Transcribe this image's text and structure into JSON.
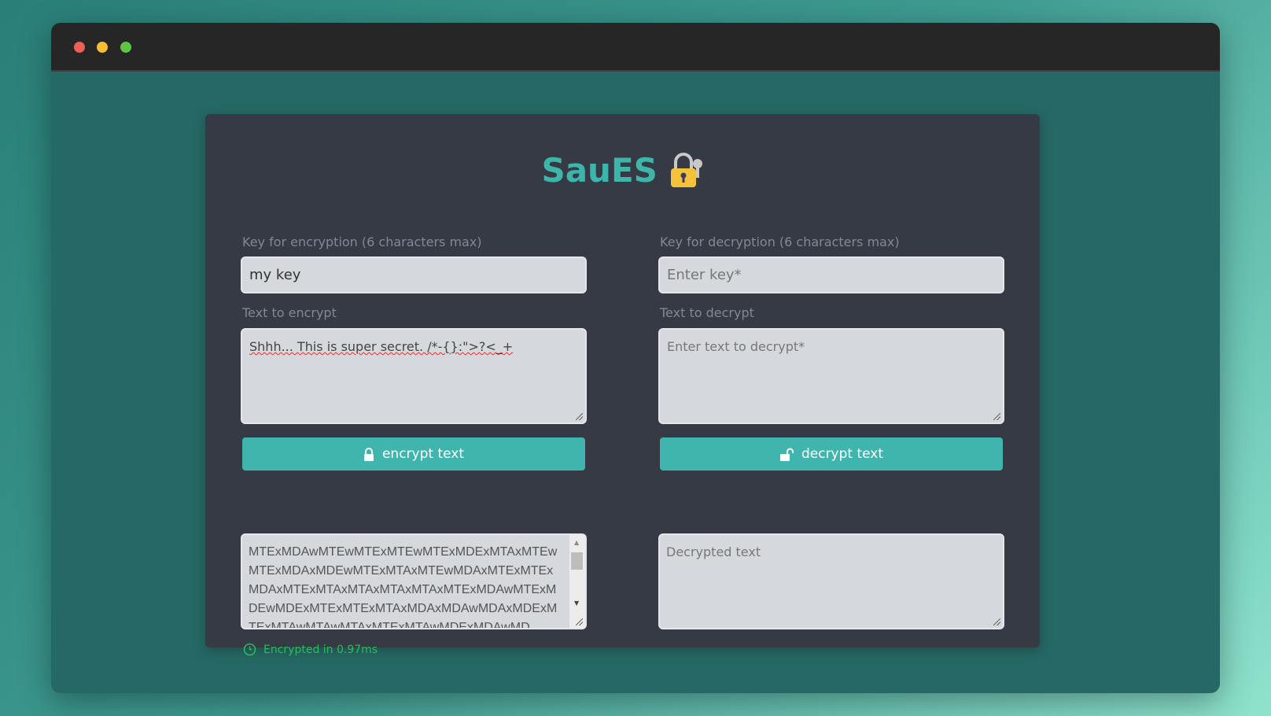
{
  "app": {
    "title": "SauES",
    "logo_icon": "lock-with-key-icon"
  },
  "encrypt": {
    "key_label": "Key for encryption (6 characters max)",
    "key_value": "my key",
    "text_label": "Text to encrypt",
    "text_value": "Shhh... This is super secret. /*-{}:\">?<_+",
    "button_label": "encrypt text",
    "output": "MTExMDAwMTEwMTExMTEwMTExMDExMTAxMTEwMTExMDAxMDEwMTExMTAxMTEwMDAxMTExMTExMDAxMTExMTAxMTAxMTAxMTAxMTExMDAwMTExMDEwMDExMTExMTExMTAxMDAxMDAwMDAxMDExMTExMTAwMTAwMTAxMTExMTAwMDExMDAwMD",
    "status": "Encrypted in 0.97ms"
  },
  "decrypt": {
    "key_label": "Key for decryption (6 characters max)",
    "key_placeholder": "Enter key*",
    "text_label": "Text to decrypt",
    "text_placeholder": "Enter text to decrypt*",
    "button_label": "decrypt text",
    "output_placeholder": "Decrypted text"
  },
  "colors": {
    "accent": "#3fb5ad",
    "card": "#363a44",
    "success": "#2bbd5a"
  }
}
